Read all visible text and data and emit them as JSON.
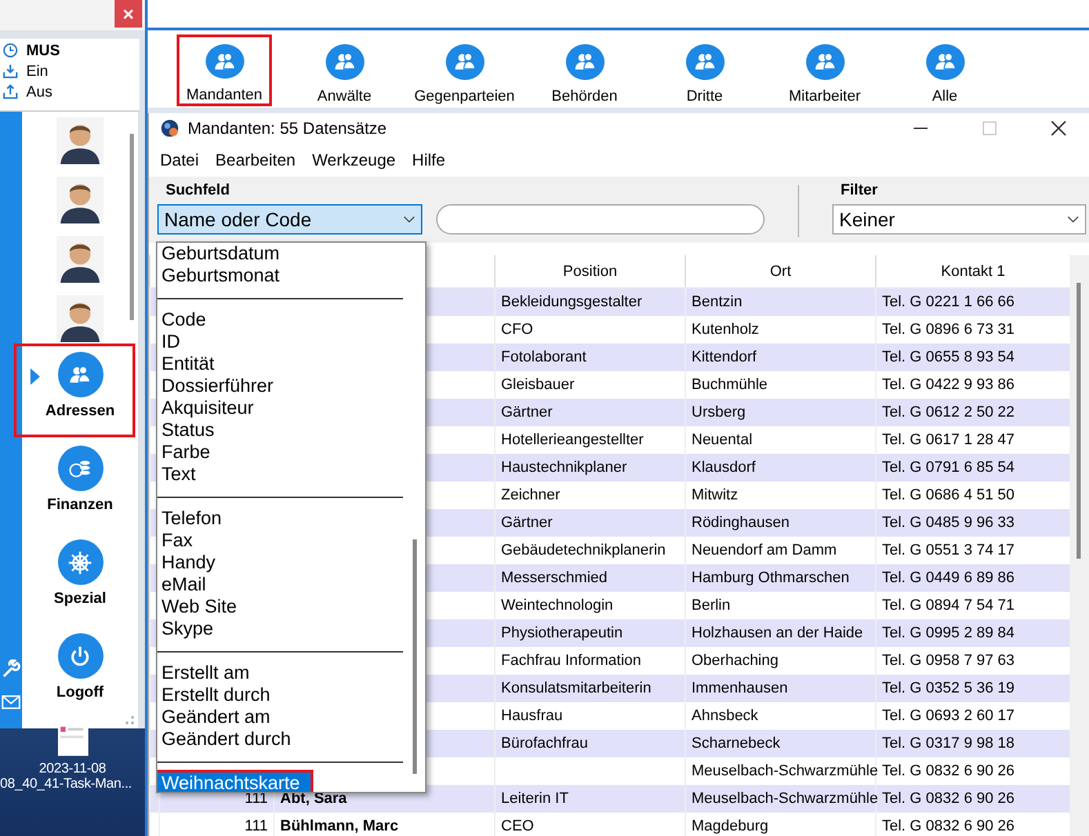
{
  "left_panel": {
    "close_button": "×",
    "user": "MUS",
    "actions": [
      {
        "kind": "in",
        "label": "Ein"
      },
      {
        "kind": "out",
        "label": "Aus"
      }
    ],
    "nav": [
      {
        "kind": "people",
        "label": "Adressen",
        "selected": true,
        "marked": true
      },
      {
        "kind": "coins",
        "label": "Finanzen",
        "selected": false,
        "marked": false
      },
      {
        "kind": "wheel",
        "label": "Spezial",
        "selected": false,
        "marked": false
      },
      {
        "kind": "power",
        "label": "Logoff",
        "selected": false,
        "marked": false
      }
    ],
    "desktop": {
      "date": "2023-11-08",
      "file": "08_40_41-Task-Man..."
    }
  },
  "toolbar": [
    {
      "label": "Mandanten",
      "marked": true
    },
    {
      "label": "Anwälte",
      "marked": false
    },
    {
      "label": "Gegenparteien",
      "marked": false
    },
    {
      "label": "Behörden",
      "marked": false
    },
    {
      "label": "Dritte",
      "marked": false
    },
    {
      "label": "Mitarbeiter",
      "marked": false
    },
    {
      "label": "Alle",
      "marked": false
    }
  ],
  "window": {
    "title": "Mandanten: 55 Datensätze",
    "menu": [
      "Datei",
      "Bearbeiten",
      "Werkzeuge",
      "Hilfe"
    ],
    "search": {
      "label": "Suchfeld",
      "field": "Name oder Code"
    },
    "filter": {
      "label": "Filter",
      "value": "Keiner"
    },
    "dropdown": [
      [
        {
          "label": "Geburtsdatum",
          "selected": false,
          "marked": false
        },
        {
          "label": "Geburtsmonat",
          "selected": false,
          "marked": false
        }
      ],
      [
        {
          "label": "Code",
          "selected": false,
          "marked": false
        },
        {
          "label": "ID",
          "selected": false,
          "marked": false
        },
        {
          "label": "Entität",
          "selected": false,
          "marked": false
        },
        {
          "label": "Dossierführer",
          "selected": false,
          "marked": false
        },
        {
          "label": "Akquisiteur",
          "selected": false,
          "marked": false
        },
        {
          "label": "Status",
          "selected": false,
          "marked": false
        },
        {
          "label": "Farbe",
          "selected": false,
          "marked": false
        },
        {
          "label": "Text",
          "selected": false,
          "marked": false
        }
      ],
      [
        {
          "label": "Telefon",
          "selected": false,
          "marked": false
        },
        {
          "label": "Fax",
          "selected": false,
          "marked": false
        },
        {
          "label": "Handy",
          "selected": false,
          "marked": false
        },
        {
          "label": "eMail",
          "selected": false,
          "marked": false
        },
        {
          "label": "Web Site",
          "selected": false,
          "marked": false
        },
        {
          "label": "Skype",
          "selected": false,
          "marked": false
        }
      ],
      [
        {
          "label": "Erstellt am",
          "selected": false,
          "marked": false
        },
        {
          "label": "Erstellt durch",
          "selected": false,
          "marked": false
        },
        {
          "label": "Geändert am",
          "selected": false,
          "marked": false
        },
        {
          "label": "Geändert durch",
          "selected": false,
          "marked": false
        }
      ],
      [
        {
          "label": "Weihnachtskarte",
          "selected": true,
          "marked": true
        }
      ]
    ],
    "table": {
      "columns": [
        "Position",
        "Ort",
        "Kontakt 1"
      ],
      "rows": [
        {
          "position": "Bekleidungsgestalter",
          "ort": "Bentzin",
          "kontakt": "Tel. G 0221 1 66 66"
        },
        {
          "position": "CFO",
          "ort": "Kutenholz",
          "kontakt": "Tel. G 0896 6 73 31"
        },
        {
          "position": "Fotolaborant",
          "ort": "Kittendorf",
          "kontakt": "Tel. G 0655 8 93 54"
        },
        {
          "position": "Gleisbauer",
          "ort": "Buchmühle",
          "kontakt": "Tel. G 0422 9 93 86"
        },
        {
          "position": "Gärtner",
          "ort": "Ursberg",
          "kontakt": "Tel. G 0612 2 50 22"
        },
        {
          "position": "Hotellerieangestellter",
          "ort": "Neuental",
          "kontakt": "Tel. G 0617 1 28 47"
        },
        {
          "position": "Haustechnikplaner",
          "ort": "Klausdorf",
          "kontakt": "Tel. G 0791 6 85 54"
        },
        {
          "position": "Zeichner",
          "ort": "Mitwitz",
          "kontakt": "Tel. G 0686 4 51 50"
        },
        {
          "position": "Gärtner",
          "ort": "Rödinghausen",
          "kontakt": "Tel. G 0485 9 96 33"
        },
        {
          "position": "Gebäudetechnikplanerin",
          "ort": "Neuendorf am Damm",
          "kontakt": "Tel. G 0551 3 74 17"
        },
        {
          "position": "Messerschmied",
          "ort": "Hamburg Othmarschen",
          "kontakt": "Tel. G 0449 6 89 86"
        },
        {
          "position": "Weintechnologin",
          "ort": "Berlin",
          "kontakt": "Tel. G 0894 7 54 71"
        },
        {
          "position": "Physiotherapeutin",
          "ort": "Holzhausen an der Haide",
          "kontakt": "Tel. G 0995 2 89 84"
        },
        {
          "position": "Fachfrau Information",
          "ort": "Oberhaching",
          "kontakt": "Tel. G 0958 7 97 63"
        },
        {
          "position": "Konsulatsmitarbeiterin",
          "ort": "Immenhausen",
          "kontakt": "Tel. G 0352 5 36 19"
        },
        {
          "position": "Hausfrau",
          "ort": "Ahnsbeck",
          "kontakt": "Tel. G 0693 2 60 17"
        },
        {
          "position": "Bürofachfrau",
          "ort": "Scharnebeck",
          "kontakt": "Tel. G 0317 9 98 18"
        },
        {
          "ort": "Meuselbach-Schwarzmühle",
          "kontakt": "Tel. G 0832 6 90 26"
        },
        {
          "number": "111",
          "name": "Abt, Sara",
          "position": "Leiterin IT",
          "ort": "Meuselbach-Schwarzmühle",
          "kontakt": "Tel. G 0832 6 90 26"
        },
        {
          "number": "111",
          "name": "Bühlmann, Marc",
          "position": "CEO",
          "ort": "Magdeburg",
          "kontakt": "Tel. G 0832 6 90 26"
        }
      ]
    }
  }
}
